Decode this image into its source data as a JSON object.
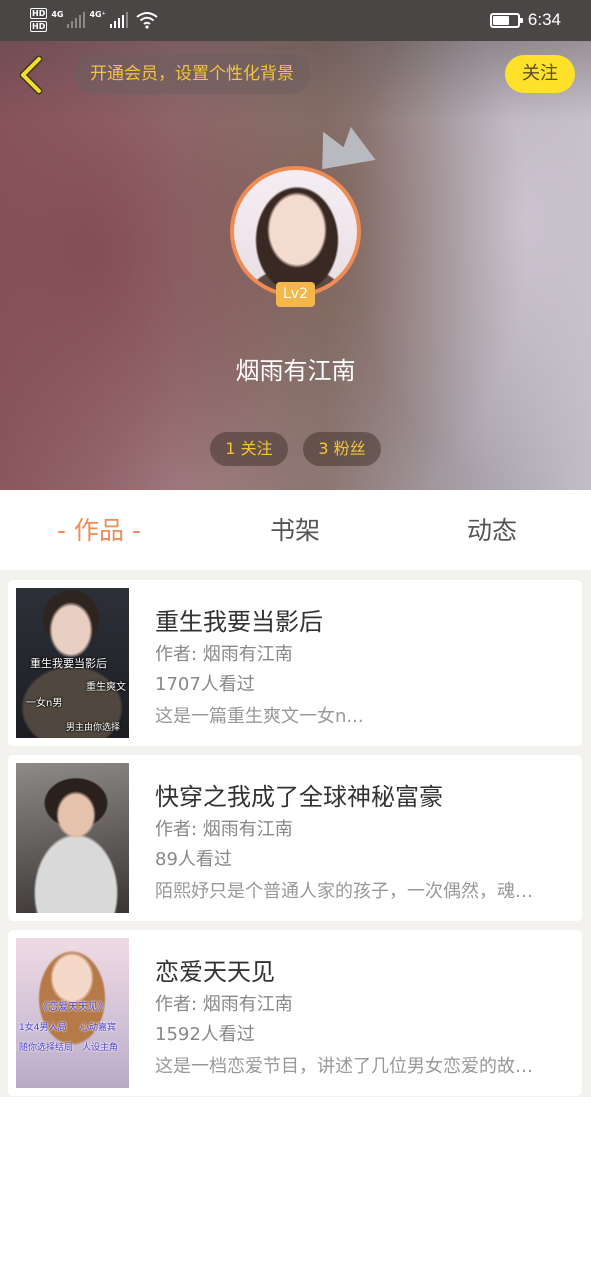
{
  "status_bar": {
    "network_labels": [
      "HD",
      "HD"
    ],
    "network_type_1": "4G",
    "network_type_2": "4G⁺",
    "time": "6:34",
    "battery_level": 0.6
  },
  "header": {
    "vip_prompt": "开通会员，设置个性化背景",
    "follow_label": "关注",
    "level": "Lv2",
    "username": "烟雨有江南",
    "following_count": "1 关注",
    "fans_count": "3 粉丝"
  },
  "tabs": [
    {
      "label": "- 作品 -",
      "active": true
    },
    {
      "label": "书架",
      "active": false
    },
    {
      "label": "动态",
      "active": false
    }
  ],
  "colors": {
    "accent": "#f08c56",
    "follow_button": "#ffe12a",
    "badge": "#f5b64a",
    "highlight_text": "#f3c53a"
  },
  "works": [
    {
      "title": "重生我要当影后",
      "author": "作者: 烟雨有江南",
      "views": "1707人看过",
      "description": "这是一篇重生爽文一女n...",
      "cover_text": [
        "重生我要当影后",
        "重生爽文",
        "一女n男",
        "男主由你选择"
      ]
    },
    {
      "title": "快穿之我成了全球神秘富豪",
      "author": "作者: 烟雨有江南",
      "views": "89人看过",
      "description": "陌熙妤只是个普通人家的孩子，一次偶然，魂…",
      "cover_text": []
    },
    {
      "title": "恋爱天天见",
      "author": "作者: 烟雨有江南",
      "views": "1592人看过",
      "description": "这是一档恋爱节目，讲述了几位男女恋爱的故…",
      "cover_text": [
        "《恋爱天天见》",
        "1女4男入局",
        "心动嘉宾",
        "随你选择结局",
        "人设主角"
      ]
    }
  ]
}
